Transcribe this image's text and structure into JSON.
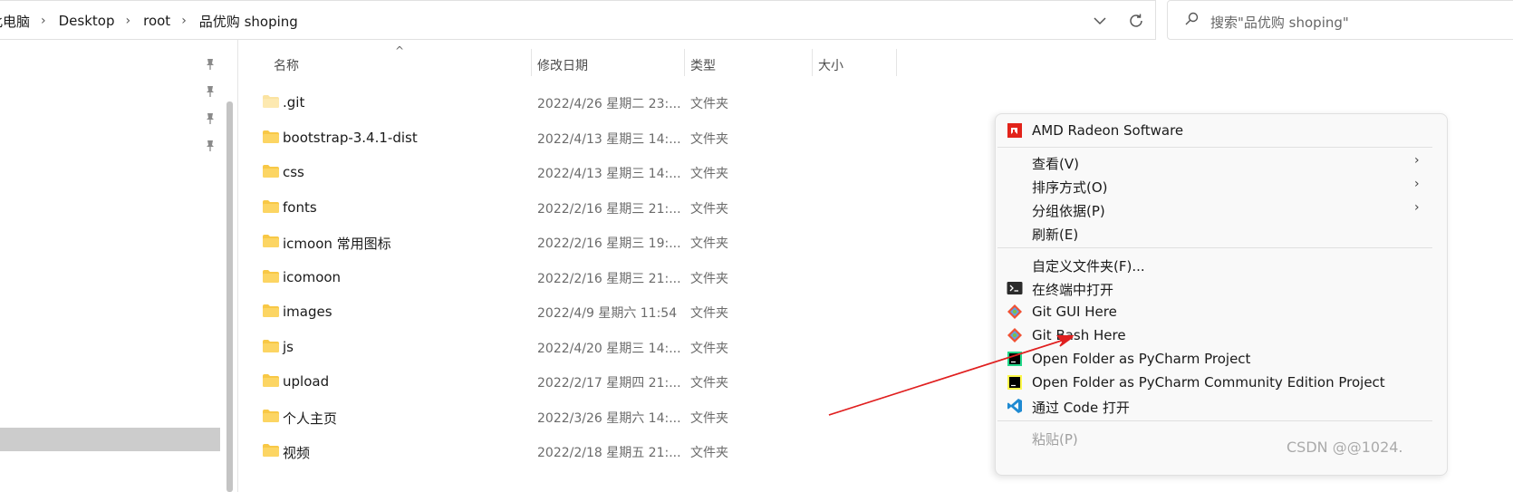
{
  "breadcrumbs": [
    "此电脑",
    "Desktop",
    "root",
    "品优购 shoping"
  ],
  "search": {
    "placeholder": "搜索\"品优购 shoping\""
  },
  "columns": [
    "名称",
    "修改日期",
    "类型",
    "大小"
  ],
  "files": [
    {
      "name": ".git",
      "date": "2022/4/26 星期二 23:...",
      "type": "文件夹",
      "hidden": true
    },
    {
      "name": "bootstrap-3.4.1-dist",
      "date": "2022/4/13 星期三 14:...",
      "type": "文件夹"
    },
    {
      "name": "css",
      "date": "2022/4/13 星期三 14:...",
      "type": "文件夹"
    },
    {
      "name": "fonts",
      "date": "2022/2/16 星期三 21:...",
      "type": "文件夹"
    },
    {
      "name": "icmoon 常用图标",
      "date": "2022/2/16 星期三 19:...",
      "type": "文件夹"
    },
    {
      "name": "icomoon",
      "date": "2022/2/16 星期三 21:...",
      "type": "文件夹"
    },
    {
      "name": "images",
      "date": "2022/4/9 星期六 11:54",
      "type": "文件夹"
    },
    {
      "name": "js",
      "date": "2022/4/20 星期三 14:...",
      "type": "文件夹"
    },
    {
      "name": "upload",
      "date": "2022/2/17 星期四 21:...",
      "type": "文件夹"
    },
    {
      "name": "个人主页",
      "date": "2022/3/26 星期六 14:...",
      "type": "文件夹"
    },
    {
      "name": "视频",
      "date": "2022/2/18 星期五 21:...",
      "type": "文件夹"
    }
  ],
  "context_menu": {
    "amd": "AMD Radeon Software",
    "view": "查看(V)",
    "sort": "排序方式(O)",
    "group": "分组依据(P)",
    "refresh": "刷新(E)",
    "customize": "自定义文件夹(F)...",
    "terminal": "在终端中打开",
    "git_gui": "Git GUI Here",
    "git_bash": "Git Bash Here",
    "pycharm": "Open Folder as PyCharm Project",
    "pycharm_ce": "Open Folder as PyCharm Community Edition Project",
    "vscode": "通过 Code 打开",
    "paste": "粘贴(P)"
  },
  "watermark": "CSDN @@1024.",
  "colors": {
    "folder": "#f8c846",
    "annotation_arrow": "#e02020",
    "amd": "#e2231a",
    "vscode": "#1f8ad2"
  }
}
